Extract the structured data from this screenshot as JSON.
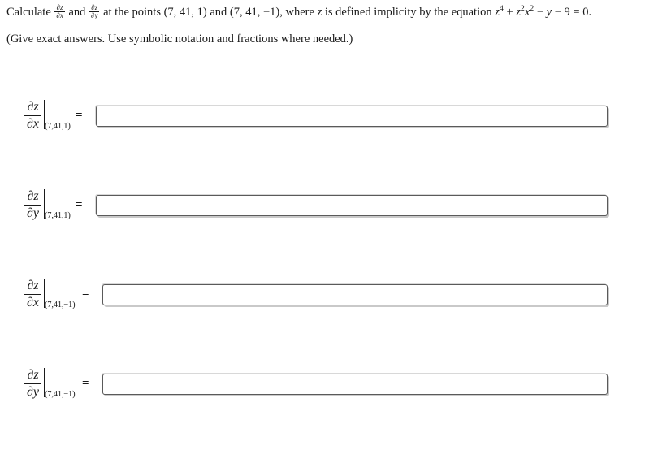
{
  "problem": {
    "prefix": "Calculate",
    "derivative_1": {
      "numerator": "∂z",
      "denominator": "∂x"
    },
    "conjunction": "and",
    "derivative_2": {
      "numerator": "∂z",
      "denominator": "∂y"
    },
    "middle": "at the points (7, 41, 1) and (7, 41, −1), where",
    "variable": "z",
    "after_variable": "is defined implicity by the equation",
    "equation": {
      "term1_base": "z",
      "term1_exp": "4",
      "plus": "+",
      "term2_base1": "z",
      "term2_exp1": "2",
      "term2_base2": "x",
      "term2_exp2": "2",
      "minus1": "−",
      "term3": "y",
      "minus2": "−",
      "term4": "9",
      "equals": "=",
      "rhs": "0."
    },
    "full_text": "Calculate ∂z/∂x and ∂z/∂y at the points (7, 41, 1) and (7, 41, −1), where z is defined implicity by the equation z⁴ + z²x² − y − 9 = 0.",
    "instruction": "(Give exact answers. Use symbolic notation and fractions where needed.)"
  },
  "answers": [
    {
      "id": "1",
      "numerator": "∂z",
      "denominator": "∂x",
      "evaluated_at": "(7,41,1)",
      "equals": "=",
      "value": "",
      "placeholder": ""
    },
    {
      "id": "2",
      "numerator": "∂z",
      "denominator": "∂y",
      "evaluated_at": "(7,41,1)",
      "equals": "=",
      "value": "",
      "placeholder": ""
    },
    {
      "id": "3",
      "numerator": "∂z",
      "denominator": "∂x",
      "evaluated_at": "(7,41,−1)",
      "equals": "=",
      "value": "",
      "placeholder": ""
    },
    {
      "id": "4",
      "numerator": "∂z",
      "denominator": "∂y",
      "evaluated_at": "(7,41,−1)",
      "equals": "=",
      "value": "",
      "placeholder": ""
    }
  ],
  "colors": {
    "page_background": "#ffffff",
    "text": "#1a1a1a",
    "input_border": "#5a5a5a",
    "input_shadow": "#c9c9c9"
  }
}
